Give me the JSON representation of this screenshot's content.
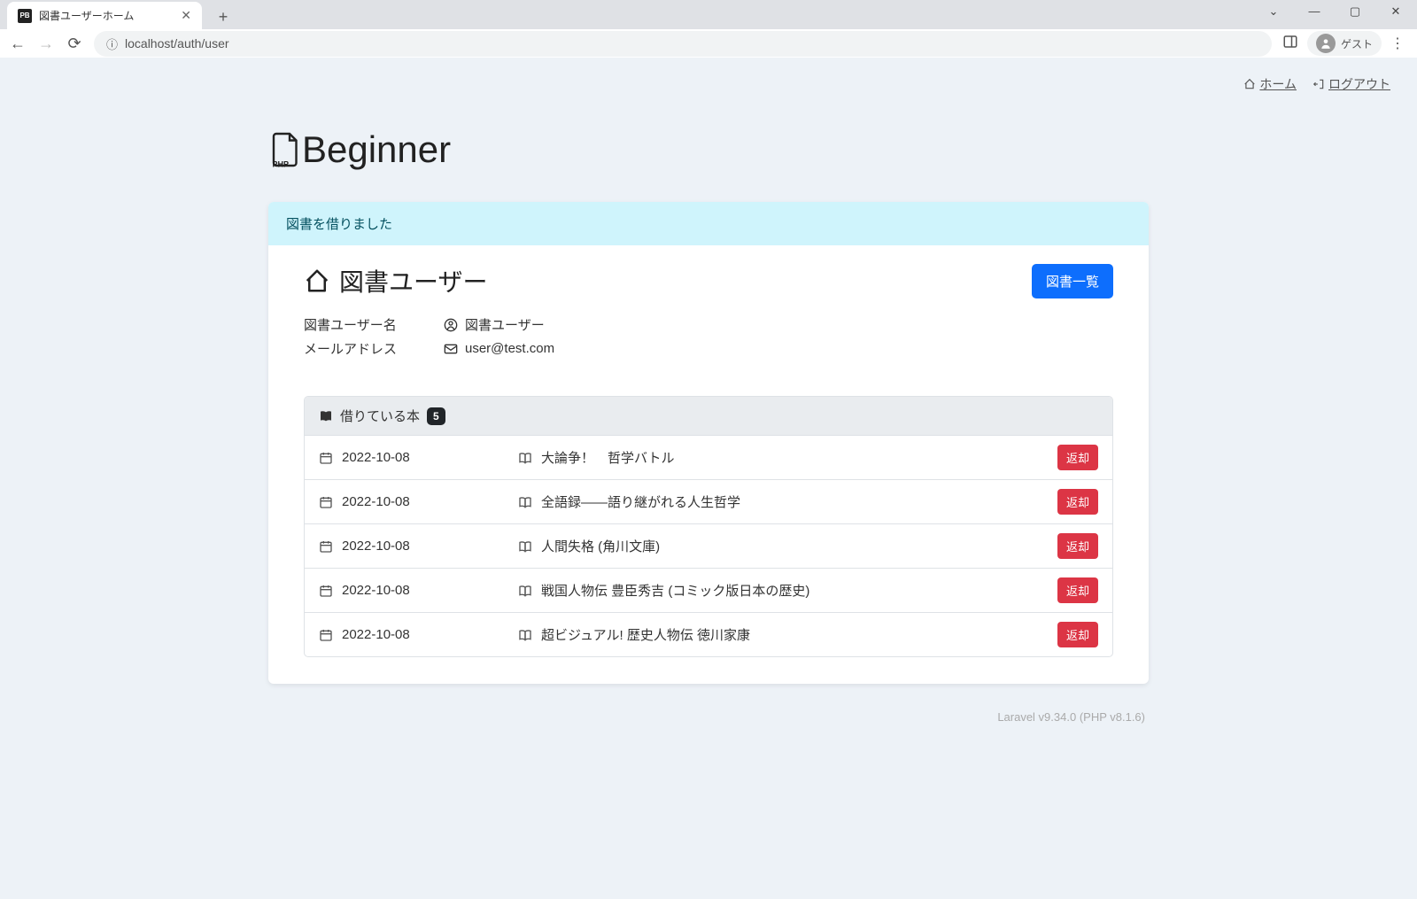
{
  "browser": {
    "tab_title": "図書ユーザーホーム",
    "url": "localhost/auth/user",
    "guest_label": "ゲスト",
    "favicon_text": "PB"
  },
  "nav": {
    "home": "ホーム",
    "logout": "ログアウト"
  },
  "brand": {
    "name": "Beginner",
    "php_label": "PHP"
  },
  "alert_message": "図書を借りました",
  "header": {
    "title": "図書ユーザー",
    "list_button": "図書一覧"
  },
  "user_info": {
    "name_label": "図書ユーザー名",
    "name_value": "図書ユーザー",
    "email_label": "メールアドレス",
    "email_value": "user@test.com"
  },
  "borrowed": {
    "label": "借りている本",
    "count": "5",
    "return_label": "返却",
    "items": [
      {
        "date": "2022-10-08",
        "title": "大論争！　哲学バトル"
      },
      {
        "date": "2022-10-08",
        "title": "全語録――語り継がれる人生哲学"
      },
      {
        "date": "2022-10-08",
        "title": "人間失格 (角川文庫)"
      },
      {
        "date": "2022-10-08",
        "title": "戦国人物伝 豊臣秀吉 (コミック版日本の歴史)"
      },
      {
        "date": "2022-10-08",
        "title": "超ビジュアル! 歴史人物伝 徳川家康"
      }
    ]
  },
  "footer": "Laravel v9.34.0 (PHP v8.1.6)"
}
